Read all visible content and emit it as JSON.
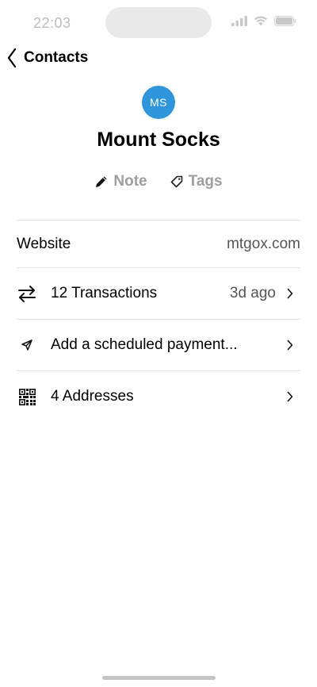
{
  "status_bar": {
    "time": "22:03"
  },
  "nav": {
    "back_label": "Contacts"
  },
  "contact": {
    "initials": "MS",
    "name": "Mount Socks",
    "avatar_color": "#2f96dc"
  },
  "actions": {
    "note_label": "Note",
    "tags_label": "Tags"
  },
  "details": {
    "website_label": "Website",
    "website_value": "mtgox.com",
    "transactions_label": "12 Transactions",
    "transactions_value": "3d ago",
    "scheduled_label": "Add a scheduled payment...",
    "addresses_label": "4 Addresses"
  },
  "icons": {
    "back": "chevron-left-icon",
    "note": "pencil-icon",
    "tags": "tag-icon",
    "transactions": "arrows-swap-icon",
    "scheduled": "send-icon",
    "addresses": "qr-code-icon",
    "chevron": "chevron-right-icon"
  }
}
